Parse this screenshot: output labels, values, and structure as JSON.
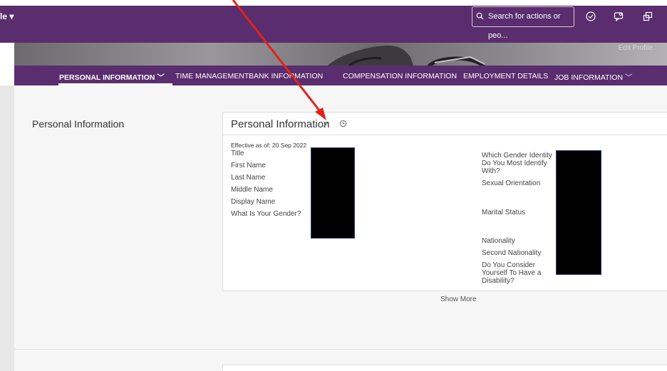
{
  "shell": {
    "app_name": "le ▾",
    "search_placeholder": "Search for actions or peo..."
  },
  "hero": {
    "edit_profile": "Edit Profile"
  },
  "tabs": [
    {
      "label": "PERSONAL INFORMATION  ﹀",
      "active": true
    },
    {
      "label": "TIME MANAGEMENT"
    },
    {
      "label": "BANK INFORMATION"
    },
    {
      "label": "COMPENSATION INFORMATION"
    },
    {
      "label": "EMPLOYMENT DETAILS"
    },
    {
      "label": "JOB INFORMATION  ﹀"
    }
  ],
  "section": {
    "label": "Personal Information"
  },
  "card": {
    "title": "Personal Information",
    "effective": "Effective as of: 20 Sep 2022",
    "left_fields": [
      "Title",
      "First Name",
      "Last Name",
      "Middle Name",
      "Display Name",
      "What Is Your Gender?"
    ],
    "right_fields": {
      "gender_identity": "Which Gender Identity Do You Most Identify With?",
      "sexual_orientation": "Sexual Orientation",
      "marital_status": "Marital Status",
      "nationality": "Nationality",
      "second_nationality": "Second Nationality",
      "disability": "Do You Consider Yourself To Have a Disability?"
    }
  },
  "show_more": "Show More",
  "colors": {
    "shell": "#5a2d6e",
    "annotation_arrow": "#e2231a"
  }
}
